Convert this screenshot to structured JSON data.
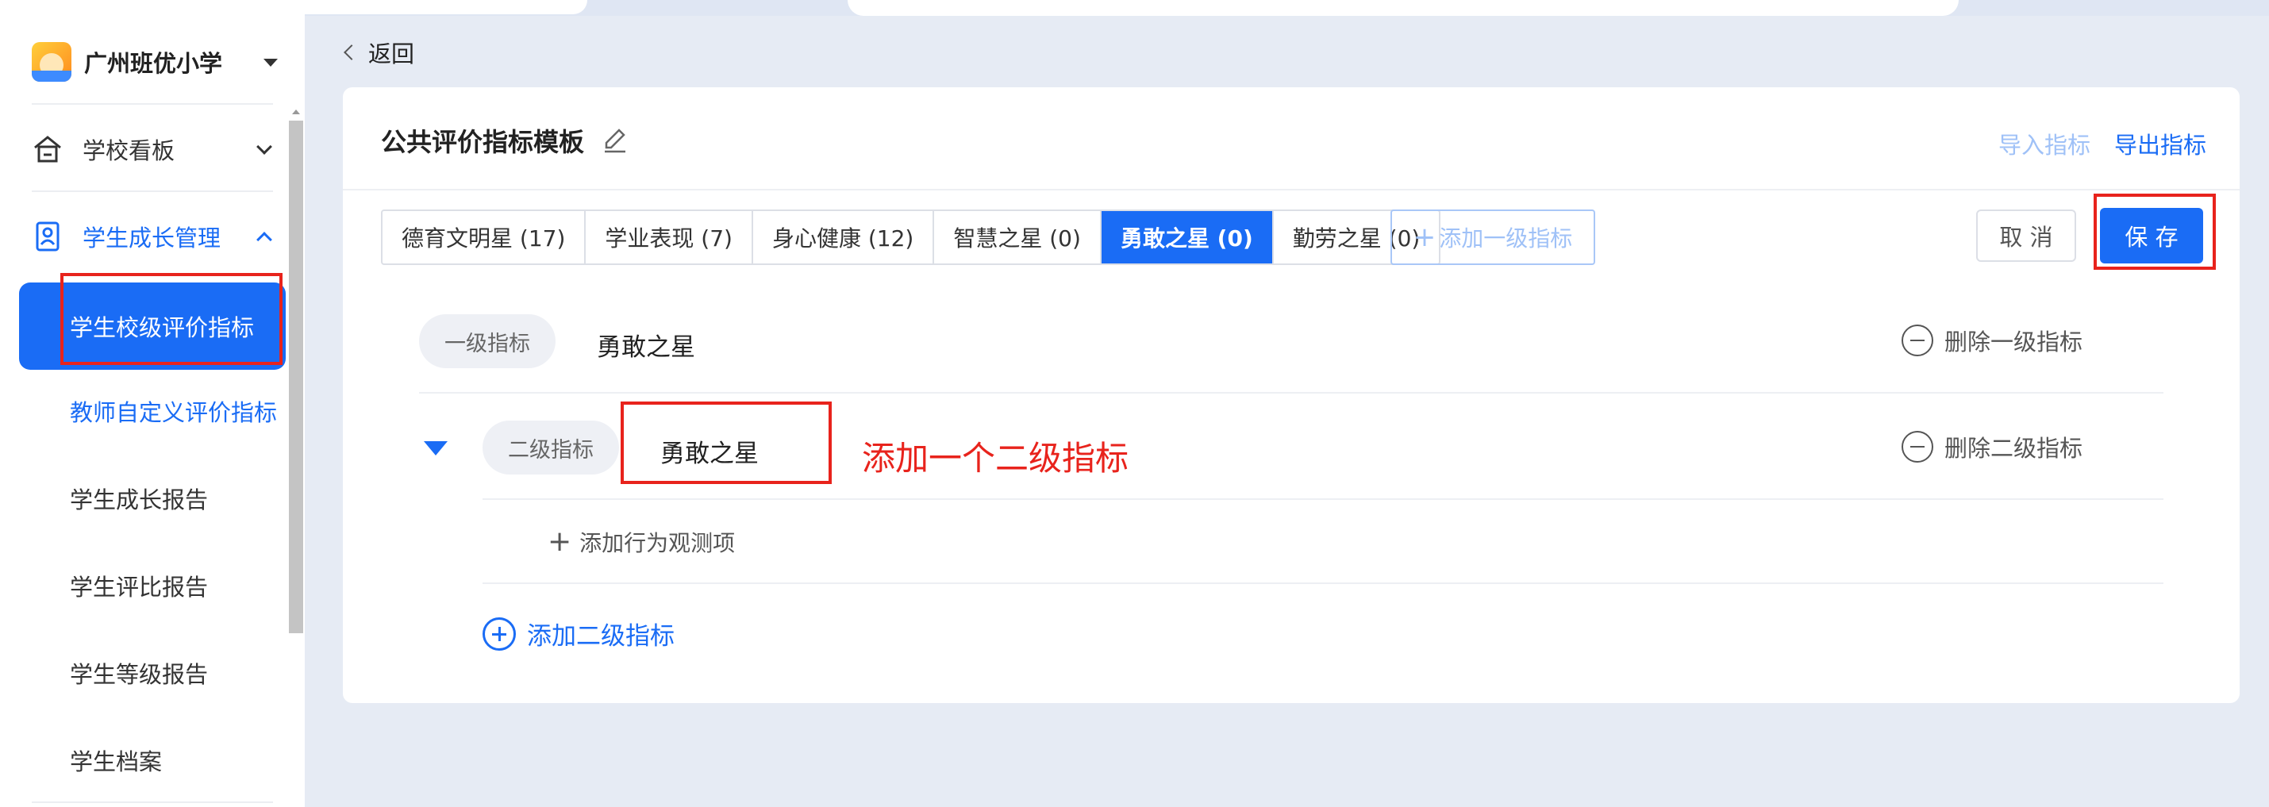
{
  "sidebar": {
    "school_name": "广州班优小学",
    "menu": [
      {
        "label": "学校看板",
        "icon": "home-icon"
      },
      {
        "label": "学生成长管理",
        "icon": "student-card-icon"
      }
    ],
    "sub_items": [
      {
        "label": "学生校级评价指标",
        "state": "active"
      },
      {
        "label": "教师自定义评价指标",
        "state": "link"
      },
      {
        "label": "学生成长报告"
      },
      {
        "label": "学生评比报告"
      },
      {
        "label": "学生等级报告"
      },
      {
        "label": "学生档案"
      }
    ]
  },
  "back_label": "返回",
  "card": {
    "title": "公共评价指标模板",
    "import_label": "导入指标",
    "export_label": "导出指标",
    "tabs": [
      {
        "label": "德育文明星 (17)"
      },
      {
        "label": "学业表现 (7)"
      },
      {
        "label": "身心健康 (12)"
      },
      {
        "label": "智慧之星 (0)"
      },
      {
        "label": "勇敢之星 (0)",
        "active": true
      },
      {
        "label": "勤劳之星 (0)"
      }
    ],
    "add_level1_tab": "添加一级指标",
    "cancel_label": "取 消",
    "save_label": "保 存",
    "level1": {
      "tag": "一级指标",
      "value": "勇敢之星",
      "delete_label": "删除一级指标"
    },
    "level2": {
      "tag": "二级指标",
      "value": "勇敢之星",
      "delete_label": "删除二级指标"
    },
    "add_behavior_label": "添加行为观测项",
    "add_level2_label": "添加二级指标"
  },
  "annotation_text": "添加一个二级指标",
  "colors": {
    "primary": "#1a6cf5",
    "annotation": "#e8231c",
    "page_bg": "#e6ebf4"
  }
}
